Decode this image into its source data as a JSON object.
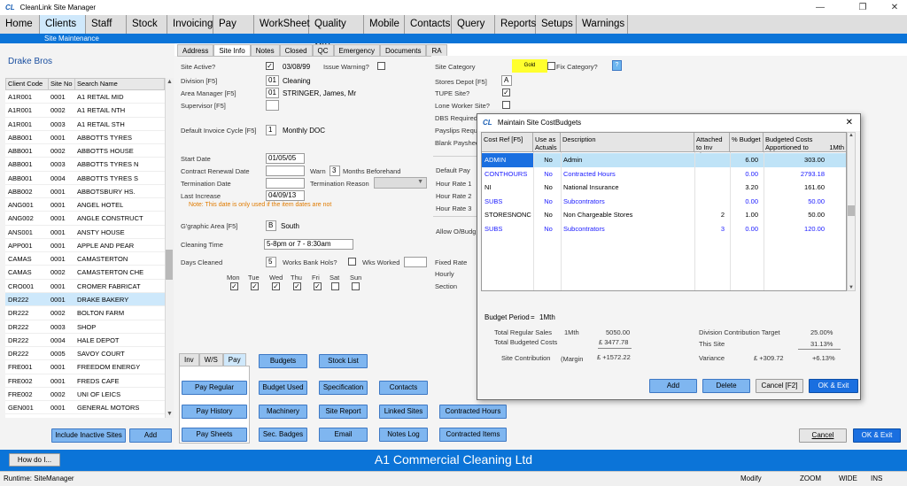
{
  "window": {
    "logo": "CL",
    "title": "CleanLink Site Manager",
    "controls": [
      "—",
      "❐",
      "✕"
    ]
  },
  "menu": [
    {
      "label": "Home",
      "active": false
    },
    {
      "label": "Clients",
      "active": true
    },
    {
      "label": "Staff",
      "active": false
    },
    {
      "label": "Stock",
      "active": false
    },
    {
      "label": "Invoicing",
      "active": false
    },
    {
      "label": "Pay",
      "active": false
    },
    {
      "label": "WorkSheet",
      "active": false
    },
    {
      "label": "Quality Ctrl",
      "active": false
    },
    {
      "label": "Mobile",
      "active": false
    },
    {
      "label": "Contacts",
      "active": false
    },
    {
      "label": "Query",
      "active": false
    },
    {
      "label": "Reports",
      "active": false
    },
    {
      "label": "Setups",
      "active": false
    },
    {
      "label": "Warnings",
      "active": false
    }
  ],
  "submenu": "Site Maintenance",
  "client_name": "Drake Bros",
  "client_table": {
    "headers": [
      "Client Code",
      "Site No",
      "Search Name"
    ],
    "rows": [
      [
        "A1R001",
        "0001",
        "A1 RETAIL MID"
      ],
      [
        "A1R001",
        "0002",
        "A1 RETAIL NTH"
      ],
      [
        "A1R001",
        "0003",
        "A1 RETAIL STH"
      ],
      [
        "ABB001",
        "0001",
        "ABBOTTS TYRES"
      ],
      [
        "ABB001",
        "0002",
        "ABBOTTS HOUSE"
      ],
      [
        "ABB001",
        "0003",
        "ABBOTTS TYRES N"
      ],
      [
        "ABB001",
        "0004",
        "ABBOTTS TYRES S"
      ],
      [
        "ABB002",
        "0001",
        "ABBOTSBURY HS."
      ],
      [
        "ANG001",
        "0001",
        "ANGEL HOTEL"
      ],
      [
        "ANG002",
        "0001",
        "ANGLE CONSTRUCT"
      ],
      [
        "ANS001",
        "0001",
        "ANSTY HOUSE"
      ],
      [
        "APP001",
        "0001",
        "APPLE AND PEAR"
      ],
      [
        "CAMAS",
        "0001",
        "CAMASTERTON"
      ],
      [
        "CAMAS",
        "0002",
        "CAMASTERTON CHE"
      ],
      [
        "CRO001",
        "0001",
        "CROMER FABRICAT"
      ],
      [
        "DR222",
        "0001",
        "DRAKE BAKERY"
      ],
      [
        "DR222",
        "0002",
        "BOLTON FARM"
      ],
      [
        "DR222",
        "0003",
        "SHOP"
      ],
      [
        "DR222",
        "0004",
        "HALE DEPOT"
      ],
      [
        "DR222",
        "0005",
        "SAVOY COURT"
      ],
      [
        "FRE001",
        "0001",
        "FREEDOM ENERGY"
      ],
      [
        "FRE002",
        "0001",
        "FREDS CAFE"
      ],
      [
        "FRE002",
        "0002",
        "UNI OF LEICS"
      ],
      [
        "GEN001",
        "0001",
        "GENERAL MOTORS"
      ]
    ],
    "selected_index": 15
  },
  "left_buttons": {
    "include_inactive": "Include Inactive Sites",
    "add": "Add"
  },
  "tabs": [
    {
      "label": "Address",
      "active": false
    },
    {
      "label": "Site Info",
      "active": true
    },
    {
      "label": "Notes",
      "active": false
    },
    {
      "label": "Closed",
      "active": false
    },
    {
      "label": "QC",
      "active": false
    },
    {
      "label": "Emergency",
      "active": false
    },
    {
      "label": "Documents",
      "active": false
    },
    {
      "label": "RA",
      "active": false
    }
  ],
  "site_info": {
    "site_active_label": "Site Active?",
    "site_active_check": "✓",
    "site_active_date": "03/08/99",
    "issue_warning_label": "Issue Warning?",
    "division_label": "Division [F5]",
    "division_code": "01",
    "division_name": "Cleaning",
    "area_manager_label": "Area Manager [F5]",
    "area_manager_code": "01",
    "area_manager_name": "STRINGER, James, Mr",
    "supervisor_label": "Supervisor [F5]",
    "invoice_cycle_label": "Default Invoice Cycle [F5]",
    "invoice_cycle_code": "1",
    "invoice_cycle_name": "Monthly DOC",
    "start_date_label": "Start Date",
    "start_date": "01/05/05",
    "renewal_label": "Contract Renewal Date",
    "warn_label": "Warn",
    "warn_months": "3",
    "months_before_label": "Months Beforehand",
    "termination_date_label": "Termination Date",
    "termination_reason_label": "Termination Reason",
    "last_increase_label": "Last Increase",
    "last_increase": "04/09/13",
    "note": "Note: This date is only used if the item dates are not",
    "geo_area_label": "G'graphic Area [F5]",
    "geo_area_code": "B",
    "geo_area_name": "South",
    "cleaning_time_label": "Cleaning Time",
    "cleaning_time": "5-8pm or 7 - 8:30am",
    "days_cleaned_label": "Days Cleaned",
    "days_cleaned": "5",
    "works_bank_hols_label": "Works Bank Hols?",
    "wks_worked_label": "Wks Worked",
    "days": [
      {
        "label": "Mon",
        "checked": "✓"
      },
      {
        "label": "Tue",
        "checked": "✓"
      },
      {
        "label": "Wed",
        "checked": "✓"
      },
      {
        "label": "Thu",
        "checked": "✓"
      },
      {
        "label": "Fri",
        "checked": "✓"
      },
      {
        "label": "Sat",
        "checked": ""
      },
      {
        "label": "Sun",
        "checked": ""
      }
    ]
  },
  "right_info": {
    "site_category_label": "Site Category",
    "site_category": "Gold",
    "fix_category_label": "Fix Category?",
    "fix_category_btn": "?",
    "stores_depot_label": "Stores Depot [F5]",
    "stores_depot": "A",
    "tupe_label": "TUPE Site?",
    "tupe_check": "✓",
    "lone_worker_label": "Lone Worker Site?",
    "dbs_label": "DBS Required",
    "payslips_label": "Payslips Requ",
    "blank_label": "Blank Paysheet",
    "default_pay_label": "Default Pay",
    "hour_rate_1": "Hour Rate 1",
    "hour_rate_2": "Hour Rate 2",
    "hour_rate_3": "Hour Rate 3",
    "allow_label": "Allow O/Budg",
    "fixed_rate_label": "Fixed Rate",
    "hourly_label": "Hourly",
    "section_label": "Section"
  },
  "subtabs": [
    "Inv",
    "W/S",
    "Pay"
  ],
  "action_buttons": {
    "pay_regular": "Pay Regular",
    "pay_history": "Pay History",
    "pay_sheets": "Pay Sheets",
    "budgets": "Budgets",
    "budget_used": "Budget Used",
    "machinery": "Machinery",
    "sec_badges": "Sec. Badges",
    "stock_list": "Stock List",
    "specification": "Specification",
    "site_report": "Site Report",
    "email": "Email",
    "contacts": "Contacts",
    "linked_sites": "Linked Sites",
    "notes_log": "Notes Log",
    "contracted_hours": "Contracted Hours",
    "contracted_items": "Contracted Items"
  },
  "bottom_buttons": {
    "cancel": "Cancel",
    "ok_exit": "OK & Exit"
  },
  "footer": {
    "how_do_i": "How do I...",
    "company": "A1 Commercial Cleaning Ltd"
  },
  "statusbar": {
    "runtime": "Runtime: SiteManager",
    "mode": "Modify",
    "zoom": "ZOOM",
    "wide": "WIDE",
    "ins": "INS"
  },
  "dialog": {
    "logo": "CL",
    "title": "Maintain Site CostBudgets",
    "close": "✕",
    "headers": [
      "Cost Ref [F5]",
      "Use as Actuals",
      "Description",
      "Attached to Inv Lin...",
      "% Budget",
      "Budgeted Costs Apportioned to",
      "1Mth"
    ],
    "rows": [
      {
        "ref": "ADMIN",
        "actuals": "No",
        "desc": "Admin",
        "attached": "",
        "pct": "6.00",
        "cost": "303.00",
        "blue": false,
        "sel": true
      },
      {
        "ref": "CONTHOURS",
        "actuals": "No",
        "desc": "Contracted Hours",
        "attached": "",
        "pct": "0.00",
        "cost": "2793.18",
        "blue": true,
        "sel": false
      },
      {
        "ref": "NI",
        "actuals": "No",
        "desc": "National Insurance",
        "attached": "",
        "pct": "3.20",
        "cost": "161.60",
        "blue": false,
        "sel": false
      },
      {
        "ref": "SUBS",
        "actuals": "No",
        "desc": "Subcontrators",
        "attached": "",
        "pct": "0.00",
        "cost": "50.00",
        "blue": true,
        "sel": false
      },
      {
        "ref": "STORESNONC",
        "actuals": "No",
        "desc": "Non Chargeable Stores",
        "attached": "2",
        "pct": "1.00",
        "cost": "50.00",
        "blue": false,
        "sel": false
      },
      {
        "ref": "SUBS",
        "actuals": "No",
        "desc": "Subcontrators",
        "attached": "3",
        "pct": "0.00",
        "cost": "120.00",
        "blue": true,
        "sel": false
      }
    ],
    "budget_period_label": "Budget Period",
    "budget_period_eq": "=",
    "budget_period": "1Mth",
    "total_sales_label": "Total Regular Sales",
    "total_sales_period": "1Mth",
    "total_sales": "5050.00",
    "total_costs_label": "Total Budgeted Costs",
    "total_costs": "£ 3477.78",
    "contribution_label": "Site Contribution",
    "margin_label": "(Margin",
    "contribution": "£ +1572.22",
    "div_target_label": "Division Contribution Target",
    "div_target": "25.00%",
    "this_site_label": "This Site",
    "this_site": "31.13%",
    "variance_label": "Variance",
    "variance_amount": "£ +309.72",
    "variance_pct": "+6.13%",
    "buttons": {
      "add": "Add",
      "delete": "Delete",
      "cancel": "Cancel [F2]",
      "ok_exit": "OK & Exit"
    }
  }
}
